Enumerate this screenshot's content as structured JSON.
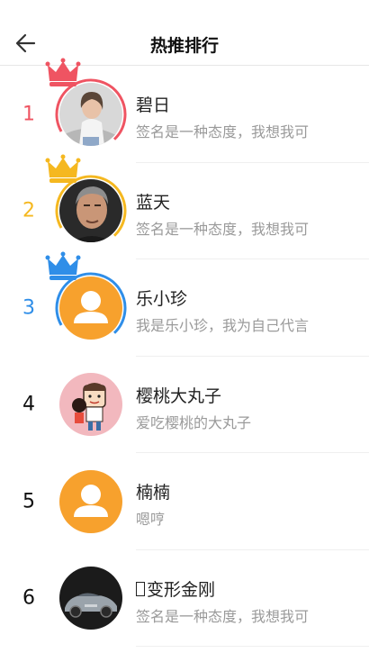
{
  "header": {
    "title": "热推排行"
  },
  "colors": {
    "gold": "#f5b820",
    "red": "#ef5462",
    "blue": "#2f8ee8",
    "orange": "#f7a12d"
  },
  "items": [
    {
      "rank": "1",
      "name": "碧日",
      "sig": "签名是一种态度，我想我可",
      "avatar": "photo-woman"
    },
    {
      "rank": "2",
      "name": "蓝天",
      "sig": "签名是一种态度，我想我可",
      "avatar": "photo-man"
    },
    {
      "rank": "3",
      "name": "乐小珍",
      "sig": "我是乐小珍，我为自己代言",
      "avatar": "default-user"
    },
    {
      "rank": "4",
      "name": "樱桃大丸子",
      "sig": "爱吃樱桃的大丸子",
      "avatar": "cartoon"
    },
    {
      "rank": "5",
      "name": "楠楠",
      "sig": "嗯哼",
      "avatar": "default-user"
    },
    {
      "rank": "6",
      "name": "变形金刚",
      "sig": "签名是一种态度，我想我可",
      "avatar": "photo-car"
    }
  ]
}
